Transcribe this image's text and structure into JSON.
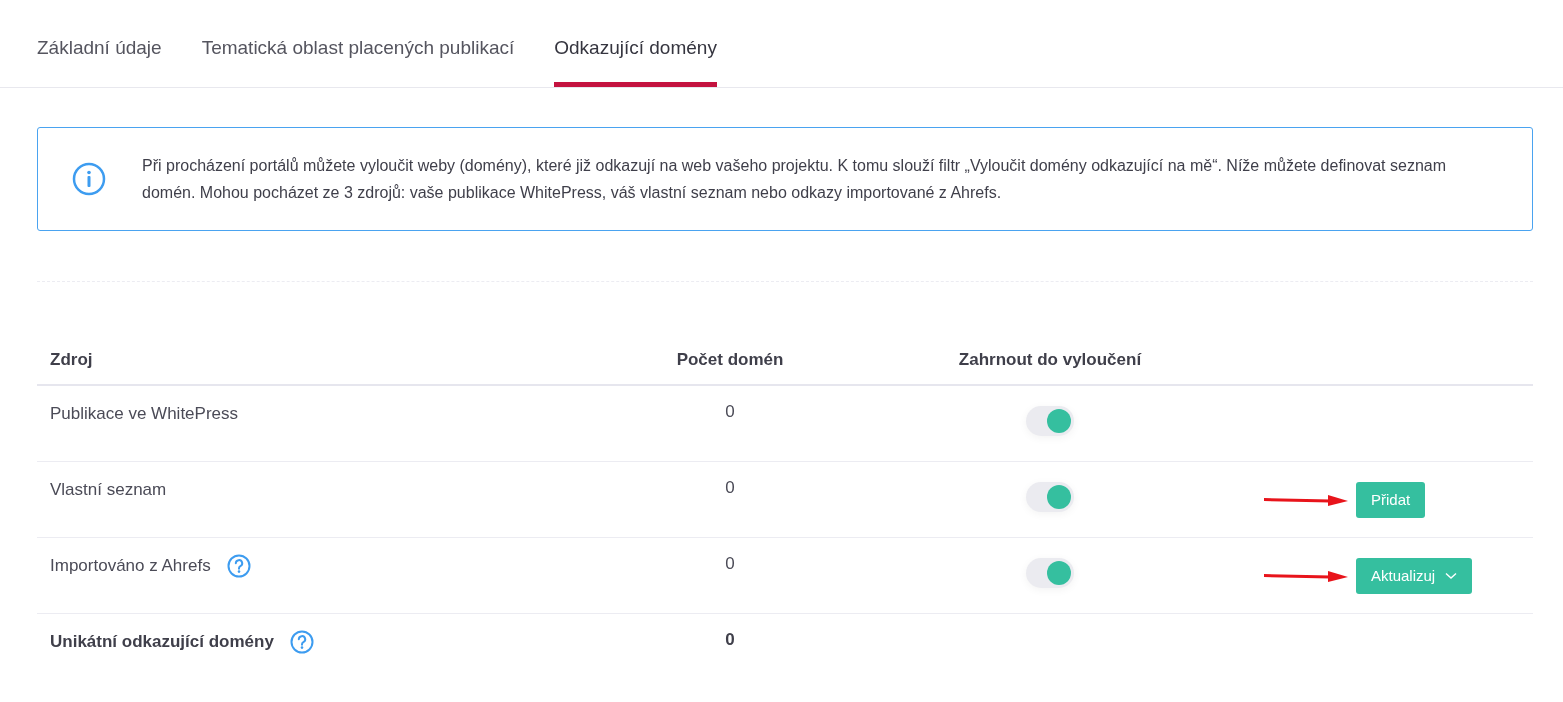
{
  "tabs": [
    {
      "label": "Základní údaje",
      "selected": false
    },
    {
      "label": "Tematická oblast placených publikací",
      "selected": false
    },
    {
      "label": "Odkazující domény",
      "selected": true
    }
  ],
  "info": {
    "text": "Při procházení portálů můžete vyloučit weby (domény), které již odkazují na web vašeho projektu. K tomu slouží filtr „Vyloučit domény odkazující na mě“. Níže můžete definovat seznam domén. Mohou pocházet ze 3 zdrojů: vaše publikace WhitePress, váš vlastní seznam nebo odkazy importované z Ahrefs."
  },
  "table": {
    "columns": [
      "Zdroj",
      "Počet domén",
      "Zahrnout do vyloučení"
    ],
    "rows": [
      {
        "kind": "source",
        "source": "Publikace ve WhitePress",
        "help": false,
        "count": "0",
        "on": true
      },
      {
        "kind": "source",
        "source": "Vlastní seznam",
        "help": false,
        "count": "0",
        "on": true,
        "action": {
          "kind": "button",
          "label": "Přidat",
          "arrow": true
        }
      },
      {
        "kind": "source",
        "source": "Importováno z Ahrefs",
        "help": true,
        "count": "0",
        "on": true,
        "action": {
          "kind": "dropdown",
          "label": "Aktualizuj",
          "arrow": true
        }
      },
      {
        "kind": "total",
        "source": "Unikátní odkazující domény",
        "help": true,
        "count": "0"
      }
    ]
  }
}
